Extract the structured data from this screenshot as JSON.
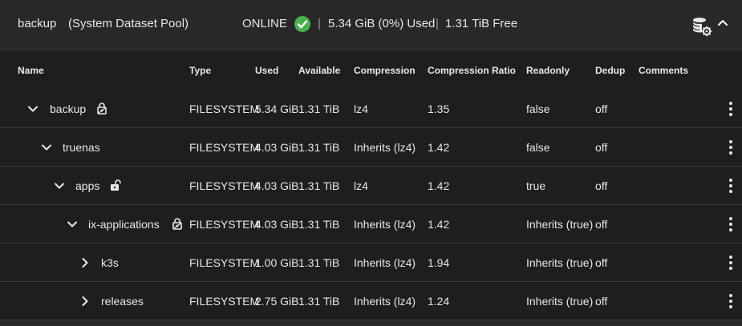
{
  "pool": {
    "name": "backup",
    "subtitle": "(System Dataset Pool)",
    "status": "ONLINE",
    "separator": "|",
    "used": "5.34 GiB (0%) Used",
    "free": "1.31 TiB Free"
  },
  "icons": {
    "status": "check-circle-icon",
    "manage": "database-settings-icon",
    "collapse": "chevron-up-icon",
    "expanded": "chevron-down-icon",
    "collapsed": "chevron-right-icon",
    "locked": "lock-icon",
    "unlocked": "lock-open-icon",
    "actions": "more-vert-icon"
  },
  "colors": {
    "status_ok": "#4caf50",
    "background": "#282828",
    "table_bg": "#1e1e1e"
  },
  "columns": [
    "Name",
    "Type",
    "Used",
    "Available",
    "Compression",
    "Compression Ratio",
    "Readonly",
    "Dedup",
    "Comments"
  ],
  "rows": [
    {
      "name": "backup",
      "type": "FILESYSTEM",
      "used": "5.34 GiB",
      "available": "1.31 TiB",
      "compression": "lz4",
      "ratio": "1.35",
      "readonly": "false",
      "dedup": "off",
      "comments": ""
    },
    {
      "name": "truenas",
      "type": "FILESYSTEM",
      "used": "4.03 GiB",
      "available": "1.31 TiB",
      "compression": "Inherits (lz4)",
      "ratio": "1.42",
      "readonly": "false",
      "dedup": "off",
      "comments": ""
    },
    {
      "name": "apps",
      "type": "FILESYSTEM",
      "used": "4.03 GiB",
      "available": "1.31 TiB",
      "compression": "lz4",
      "ratio": "1.42",
      "readonly": "true",
      "dedup": "off",
      "comments": ""
    },
    {
      "name": "ix-applications",
      "type": "FILESYSTEM",
      "used": "4.03 GiB",
      "available": "1.31 TiB",
      "compression": "Inherits (lz4)",
      "ratio": "1.42",
      "readonly": "Inherits (true)",
      "dedup": "off",
      "comments": ""
    },
    {
      "name": "k3s",
      "type": "FILESYSTEM",
      "used": "1.00 GiB",
      "available": "1.31 TiB",
      "compression": "Inherits (lz4)",
      "ratio": "1.94",
      "readonly": "Inherits (true)",
      "dedup": "off",
      "comments": ""
    },
    {
      "name": "releases",
      "type": "FILESYSTEM",
      "used": "2.75 GiB",
      "available": "1.31 TiB",
      "compression": "Inherits (lz4)",
      "ratio": "1.24",
      "readonly": "Inherits (true)",
      "dedup": "off",
      "comments": ""
    }
  ]
}
